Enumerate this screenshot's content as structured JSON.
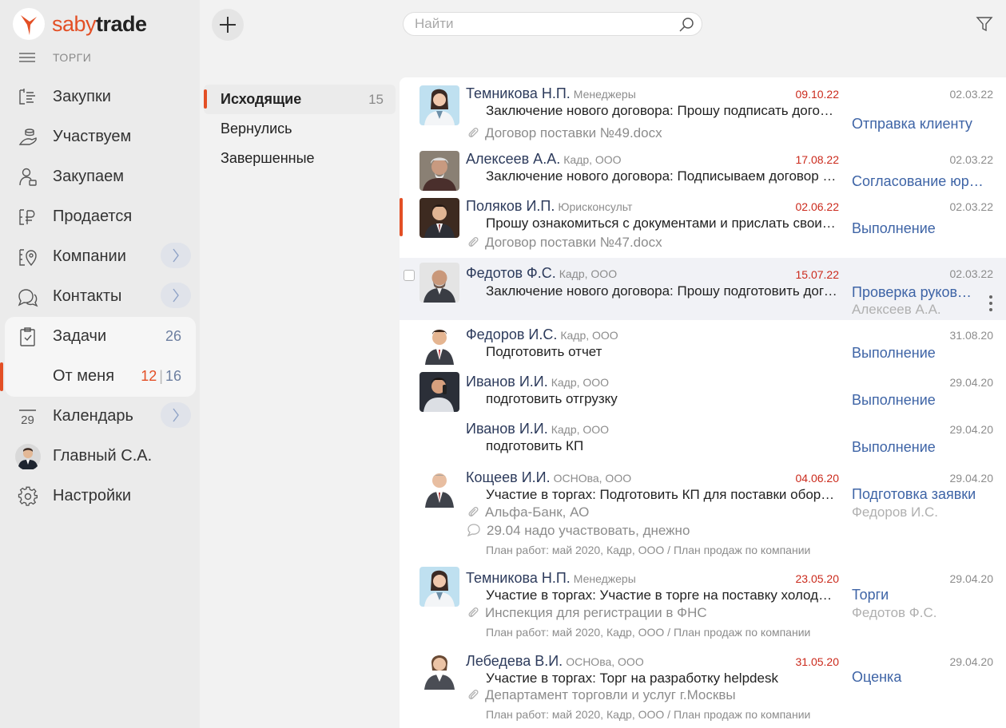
{
  "app": {
    "logo_part1": "saby",
    "logo_part2": "trade",
    "section_title": "ТОРГИ"
  },
  "colors": {
    "accent": "#e34f25",
    "link": "#3e64a6",
    "deadline": "#cb2a1c"
  },
  "sidebar": {
    "items": [
      {
        "label": "Закупки",
        "icon": "clipboard-list-icon"
      },
      {
        "label": "Участвуем",
        "icon": "hand-coins-icon"
      },
      {
        "label": "Закупаем",
        "icon": "buyer-icon"
      },
      {
        "label": "Продается",
        "icon": "price-tag-icon"
      },
      {
        "label": "Компании",
        "icon": "building-pin-icon"
      },
      {
        "label": "Контакты",
        "icon": "chat-bubbles-icon"
      },
      {
        "label": "Задачи",
        "icon": "task-clipboard-icon",
        "count": "26"
      },
      {
        "label": "От меня",
        "count_red": "12",
        "count_sep": "|",
        "count": "16"
      },
      {
        "label": "Календарь",
        "icon": "calendar-icon",
        "icon_text": "29"
      },
      {
        "label": "Главный С.А.",
        "icon": "user-avatar"
      },
      {
        "label": "Настройки",
        "icon": "gear-icon"
      }
    ]
  },
  "search": {
    "placeholder": "Найти"
  },
  "folders": [
    {
      "label": "Исходящие",
      "count": "15"
    },
    {
      "label": "Вернулись"
    },
    {
      "label": "Завершенные"
    }
  ],
  "tasks": [
    {
      "name": "Темникова Н.П.",
      "role": "Менеджеры",
      "deadline": "09.10.22",
      "date": "02.03.22",
      "desc": "Заключение нового договора: Прошу подписать договор поставки",
      "attachment": "Договор поставки №49.docx",
      "stage": "Отправка клиенту"
    },
    {
      "name": "Алексеев А.А.",
      "role": "Кадр, ООО",
      "deadline": "17.08.22",
      "date": "02.03.22",
      "desc": "Заключение нового договора: Подписываем договор поставки",
      "stage": "Согласование юридическим отделом"
    },
    {
      "name": "Поляков И.П.",
      "role": "Юрисконсульт",
      "deadline": "02.06.22",
      "date": "02.03.22",
      "desc": "Прошу ознакомиться с документами и прислать свои замечания",
      "attachment": "Договор поставки №47.docx",
      "stage": "Выполнение"
    },
    {
      "name": "Федотов Ф.С.",
      "role": "Кадр, ООО",
      "deadline": "15.07.22",
      "date": "02.03.22",
      "desc": "Заключение нового договора: Прошу подготовить договор поставки",
      "stage": "Проверка руководителем",
      "stage_user": "Алексеев А.А."
    },
    {
      "name": "Федоров И.С.",
      "role": "Кадр, ООО",
      "date": "31.08.20",
      "desc": "Подготовить отчет",
      "stage": "Выполнение"
    },
    {
      "name": "Иванов И.И.",
      "role": "Кадр, ООО",
      "date": "29.04.20",
      "desc": "подготовить отгрузку",
      "stage": "Выполнение"
    },
    {
      "name": "Иванов И.И.",
      "role": "Кадр, ООО",
      "date": "29.04.20",
      "desc": "подготовить КП",
      "stage": "Выполнение"
    },
    {
      "name": "Кощеев И.И.",
      "role": "ОСНОва, ООО",
      "deadline": "04.06.20",
      "date": "29.04.20",
      "desc": "Участие в торгах: Подготовить КП для поставки оборудования",
      "attachment": "Альфа-Банк, АО",
      "comment": "29.04 надо участвовать, днежно",
      "plan": "План работ: май 2020, Кадр, ООО / План продаж по компании",
      "stage": "Подготовка заявки",
      "stage_user": "Федоров И.С."
    },
    {
      "name": "Темникова Н.П.",
      "role": "Менеджеры",
      "deadline": "23.05.20",
      "date": "29.04.20",
      "desc": "Участие в торгах: Участие в торге на поставку холодильного оборудования",
      "attachment": "Инспекция для регистрации в ФНС",
      "plan": "План работ: май 2020, Кадр, ООО / План продаж по компании",
      "stage": "Торги",
      "stage_user": "Федотов Ф.С."
    },
    {
      "name": "Лебедева В.И.",
      "role": "ОСНОва, ООО",
      "deadline": "31.05.20",
      "date": "29.04.20",
      "desc": "Участие в торгах: Торг на разработку helpdesk",
      "attachment": "Департамент торговли и услуг г.Москвы",
      "plan": "План работ: май 2020, Кадр, ООО / План продаж по компании",
      "stage": "Оценка"
    }
  ]
}
